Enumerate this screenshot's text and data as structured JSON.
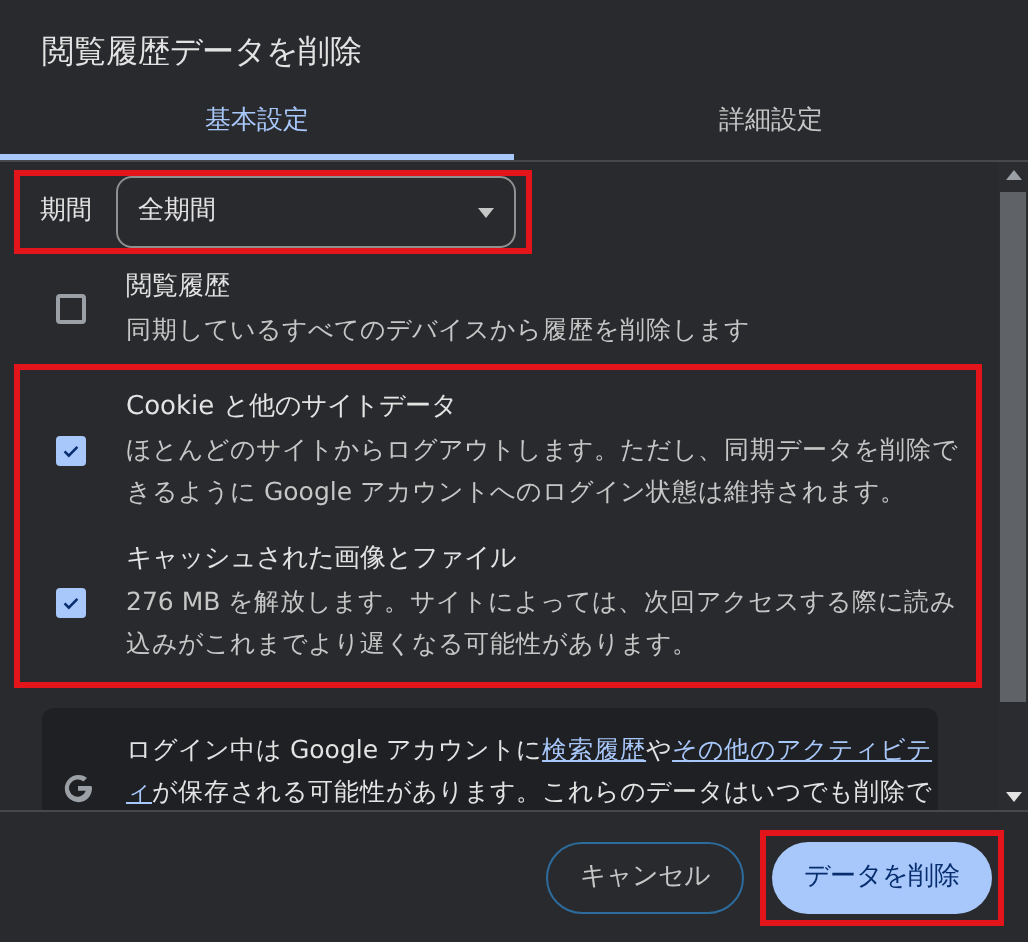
{
  "dialog": {
    "title": "閲覧履歴データを削除"
  },
  "tabs": [
    {
      "label": "基本設定",
      "selected": true
    },
    {
      "label": "詳細設定",
      "selected": false
    }
  ],
  "period": {
    "label": "期間",
    "value": "全期間"
  },
  "options": [
    {
      "title": "閲覧履歴",
      "description": [
        "同期しているすべてのデバイスから履歴を削除します"
      ],
      "checked": false,
      "highlighted": false
    },
    {
      "title": "Cookie と他のサイトデータ",
      "description": [
        "ほとんどのサイトからログアウトします。ただし、同期データを削除で",
        "きるように Google アカウントへのログイン状態は維持されます。"
      ],
      "checked": true,
      "highlighted": true
    },
    {
      "title": "キャッシュされた画像とファイル",
      "description": [
        "276 MB を解放します。サイトによっては、次回アクセスする際に読み",
        "込みがこれまでより遅くなる可能性があります。"
      ],
      "checked": true,
      "highlighted": true
    }
  ],
  "info": {
    "lines": [
      [
        {
          "kind": "text",
          "text": "ログイン中は Google アカウントに"
        },
        {
          "kind": "link",
          "text": "検索履歴"
        },
        {
          "kind": "text",
          "text": "や"
        },
        {
          "kind": "link",
          "text": "その他のアクティビテ"
        }
      ],
      [
        {
          "kind": "link",
          "text": "ィ"
        },
        {
          "kind": "text",
          "text": "が保存される可能性があります。これらのデータはいつでも削除で"
        }
      ]
    ]
  },
  "buttons": [
    {
      "label": "キャンセル",
      "kind": "secondary",
      "highlighted": false
    },
    {
      "label": "データを削除",
      "kind": "primary",
      "highlighted": true
    }
  ]
}
